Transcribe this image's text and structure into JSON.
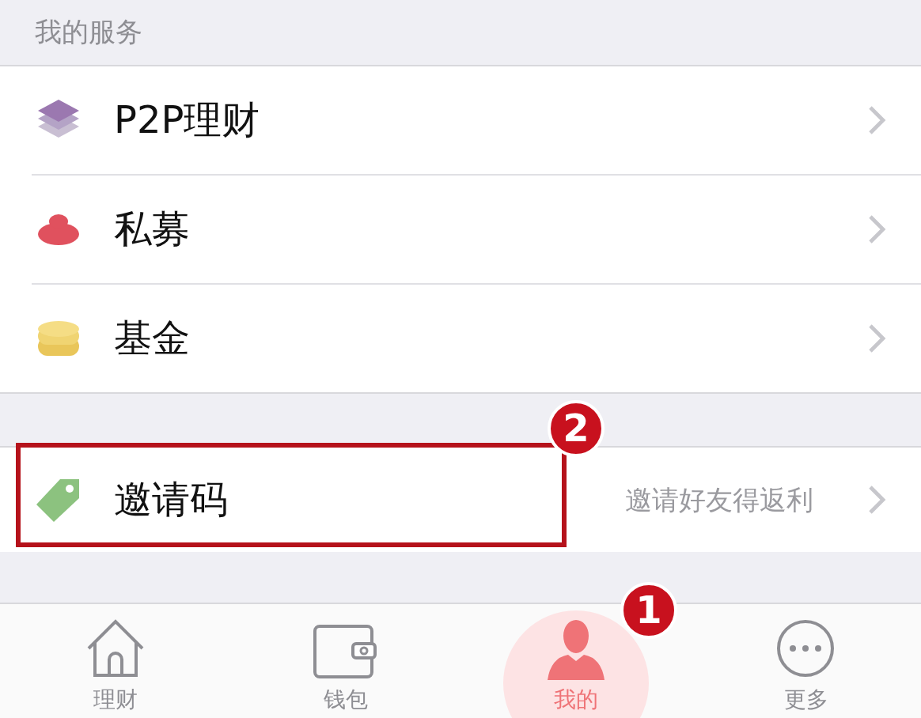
{
  "section_header": "我的服务",
  "services": [
    {
      "kind": "layers",
      "label": "P2P理财"
    },
    {
      "kind": "private",
      "label": "私募"
    },
    {
      "kind": "coins",
      "label": "基金"
    }
  ],
  "invite": {
    "label": "邀请码",
    "hint": "邀请好友得返利"
  },
  "tab_bar": [
    {
      "kind": "home",
      "label": "理财",
      "selected": false
    },
    {
      "kind": "wallet",
      "label": "钱包",
      "selected": false
    },
    {
      "kind": "user",
      "label": "我的",
      "selected": true
    },
    {
      "kind": "more",
      "label": "更多",
      "selected": false
    }
  ],
  "annotations": [
    {
      "label": "1"
    },
    {
      "label": "2"
    }
  ]
}
